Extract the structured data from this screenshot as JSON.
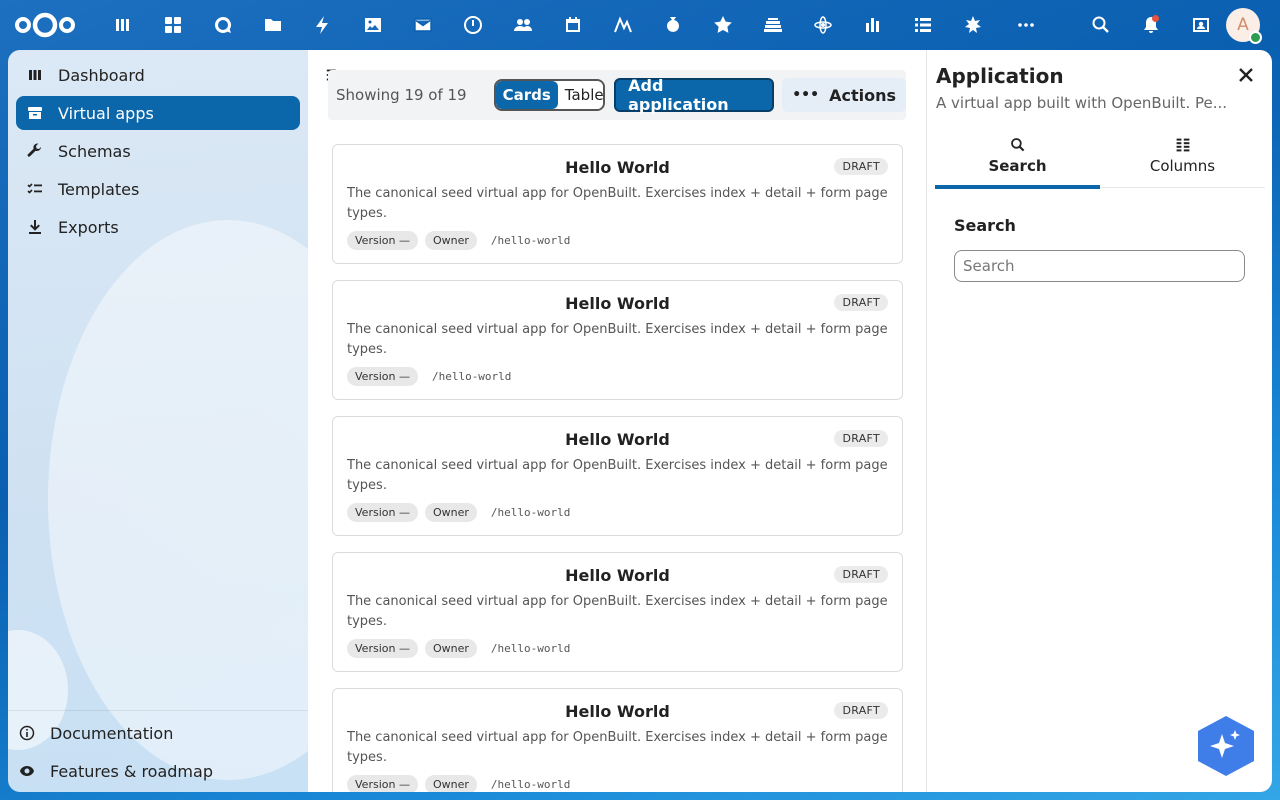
{
  "header": {
    "apps": [
      {
        "icon": "dashboard-icon",
        "label": "Dashboard"
      },
      {
        "icon": "apps-grid-icon",
        "label": "Apps"
      },
      {
        "icon": "talk-icon",
        "label": "Talk"
      },
      {
        "icon": "files-icon",
        "label": "Files"
      },
      {
        "icon": "activity-icon",
        "label": "Activity"
      },
      {
        "icon": "photos-icon",
        "label": "Photos"
      },
      {
        "icon": "mail-icon",
        "label": "Mail"
      },
      {
        "icon": "clock-icon",
        "label": "Clock"
      },
      {
        "icon": "contacts-icon",
        "label": "Contacts"
      },
      {
        "icon": "calendar-icon",
        "label": "Calendar"
      },
      {
        "icon": "analytics-icon",
        "label": "Analytics"
      },
      {
        "icon": "money-bag-icon",
        "label": "Finance"
      },
      {
        "icon": "star-icon",
        "label": "Favorites"
      },
      {
        "icon": "stack-icon",
        "label": "Deck"
      },
      {
        "icon": "atom-icon",
        "label": "Integrations"
      },
      {
        "icon": "bar-chart-icon",
        "label": "Stats"
      },
      {
        "icon": "list-icon",
        "label": "Tasks"
      },
      {
        "icon": "wizard-icon",
        "label": "OpenBuilt"
      },
      {
        "icon": "more-icon",
        "label": "More"
      }
    ]
  },
  "nav": {
    "items": [
      {
        "label": "Dashboard",
        "icon": "dashboard-icon"
      },
      {
        "label": "Virtual apps",
        "icon": "archive-icon",
        "active": true
      },
      {
        "label": "Schemas",
        "icon": "wrench-icon"
      },
      {
        "label": "Templates",
        "icon": "checklist-icon"
      },
      {
        "label": "Exports",
        "icon": "download-icon"
      }
    ],
    "footer": [
      {
        "label": "Documentation",
        "icon": "info-icon"
      },
      {
        "label": "Features & roadmap",
        "icon": "eye-icon"
      }
    ]
  },
  "toolbar": {
    "showing": "Showing 19 of 19",
    "view_cards": "Cards",
    "view_table": "Table",
    "add_label": "Add application",
    "actions_label": "Actions"
  },
  "cards": [
    {
      "title": "Hello World",
      "badge": "DRAFT",
      "description": "The canonical seed virtual app for OpenBuilt. Exercises index + detail + form page types.",
      "version": "Version —",
      "owner": "Owner",
      "slug": "/hello-world"
    },
    {
      "title": "Hello World",
      "badge": "DRAFT",
      "description": "The canonical seed virtual app for OpenBuilt. Exercises index + detail + form page types.",
      "version": "Version —",
      "owner": null,
      "slug": "/hello-world"
    },
    {
      "title": "Hello World",
      "badge": "DRAFT",
      "description": "The canonical seed virtual app for OpenBuilt. Exercises index + detail + form page types.",
      "version": "Version —",
      "owner": "Owner",
      "slug": "/hello-world"
    },
    {
      "title": "Hello World",
      "badge": "DRAFT",
      "description": "The canonical seed virtual app for OpenBuilt. Exercises index + detail + form page types.",
      "version": "Version —",
      "owner": "Owner",
      "slug": "/hello-world"
    },
    {
      "title": "Hello World",
      "badge": "DRAFT",
      "description": "The canonical seed virtual app for OpenBuilt. Exercises index + detail + form page types.",
      "version": "Version —",
      "owner": "Owner",
      "slug": "/hello-world"
    }
  ],
  "sidebar": {
    "title": "Application",
    "subtitle": "A virtual app built with OpenBuilt. Pe...",
    "tabs": [
      {
        "label": "Search",
        "icon": "search-icon",
        "active": true
      },
      {
        "label": "Columns",
        "icon": "columns-icon"
      }
    ],
    "section_title": "Search",
    "search_placeholder": "Search"
  },
  "colors": {
    "primary": "#0b67aa",
    "header_bg": "#0a5fb0",
    "ai_button": "#3f7ee8"
  }
}
